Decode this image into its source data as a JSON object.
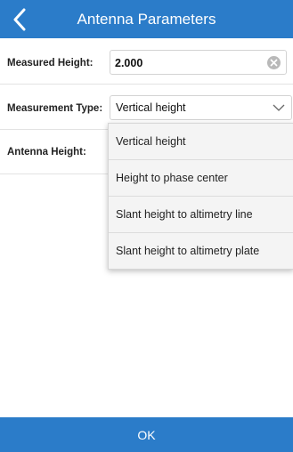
{
  "header": {
    "title": "Antenna Parameters",
    "back_icon": "chevron-left-icon"
  },
  "form": {
    "measured_height": {
      "label": "Measured Height:",
      "value": "2.000",
      "clear_icon": "clear-circle-icon"
    },
    "measurement_type": {
      "label": "Measurement Type:",
      "selected": "Vertical height",
      "dropdown_icon": "chevron-down-icon"
    },
    "antenna_height": {
      "label": "Antenna Height:"
    }
  },
  "dropdown": {
    "options": [
      "Vertical height",
      "Height to phase center",
      "Slant height to altimetry line",
      "Slant height to altimetry plate"
    ]
  },
  "footer": {
    "ok_label": "OK"
  },
  "colors": {
    "accent": "#2b7cc9",
    "background": "#ffffff",
    "divider": "#e3e3e3"
  }
}
